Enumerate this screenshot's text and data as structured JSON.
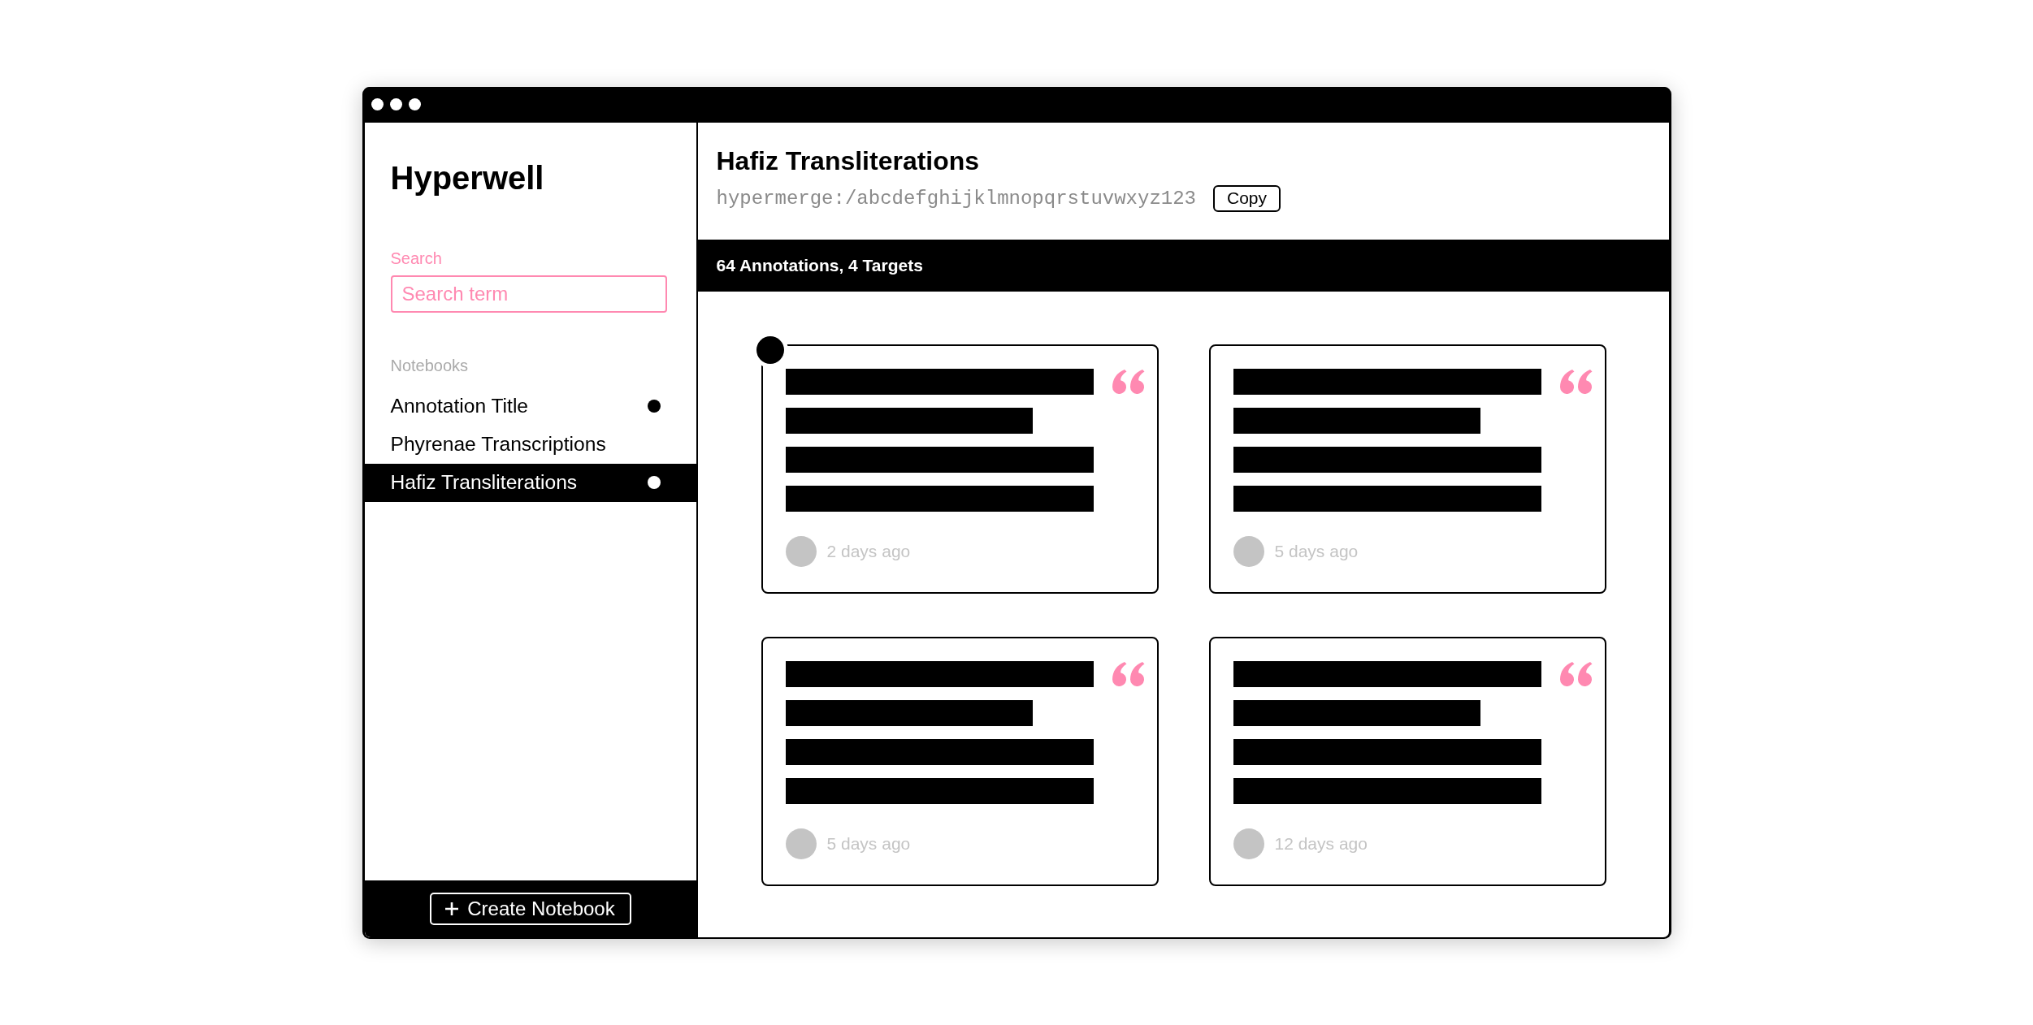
{
  "sidebar": {
    "app_name": "Hyperwell",
    "search": {
      "label": "Search",
      "placeholder": "Search term"
    },
    "notebooks_heading": "Notebooks",
    "notebooks": [
      {
        "title": "Annotation Title",
        "selected": false,
        "indicator": true
      },
      {
        "title": "Phyrenae Transcriptions",
        "selected": false,
        "indicator": false
      },
      {
        "title": "Hafiz Transliterations",
        "selected": true,
        "indicator": true
      }
    ],
    "create_button": "Create Notebook"
  },
  "notebook": {
    "title": "Hafiz Transliterations",
    "url": "hypermerge:/abcdefghijklmnopqrstuvwxyz123",
    "copy_button": "Copy",
    "summary": "64 Annotations, 4 Targets"
  },
  "annotations": [
    {
      "time": "2 days ago",
      "marker": true
    },
    {
      "time": "5 days ago",
      "marker": false
    },
    {
      "time": "5 days ago",
      "marker": false
    },
    {
      "time": "12 days ago",
      "marker": false
    }
  ]
}
